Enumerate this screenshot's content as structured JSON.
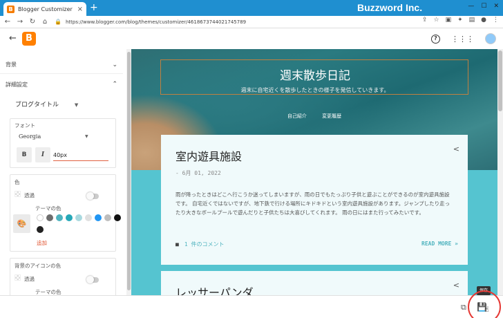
{
  "browser": {
    "tab_title": "Blogger Customizer",
    "tab_close": "×",
    "new_tab": "+",
    "brand": "Buzzword Inc.",
    "url": "https://www.blogger.com/blog/themes/customizer/4618673744021745789",
    "nav_back": "←",
    "nav_forward": "→",
    "nav_reload": "↻",
    "nav_home": "⌂",
    "lock": "🔒",
    "window_min": "—",
    "window_max": "☐",
    "window_close": "✕",
    "toolbar_icons": {
      "share": "⇪",
      "star": "☆",
      "ext": "▣",
      "puzzle": "✦",
      "sidebar": "▤",
      "profile": "●",
      "menu": "⋮"
    }
  },
  "header": {
    "back": "←",
    "logo_letter": "B",
    "help": "?",
    "apps": "⋮⋮⋮"
  },
  "sidebar": {
    "background_label": "背景",
    "advanced_label": "詳細設定",
    "chevron_down": "⌄",
    "chevron_up": "⌃",
    "selected_item": "ブログタイトル",
    "select_arrow": "▼",
    "font_card": {
      "label": "フォント",
      "font_name": "Georgia",
      "arrow": "▼",
      "bold": "B",
      "italic": "I",
      "size": "40px"
    },
    "color_card": {
      "label": "色",
      "transparent": "透過",
      "theme_colors": "テーマの色",
      "palette_icon": "🎨",
      "add": "追加",
      "colors": [
        "#ffffff",
        "#6d6d6d",
        "#4fb3bf",
        "#26a8b8",
        "#a9d9df",
        "#e0e0e0",
        "#2196f3",
        "#bdbdbd",
        "#111111",
        "#222222"
      ]
    },
    "icon_color_card": {
      "label": "背景のアイコンの色",
      "transparent": "透過",
      "theme_colors": "テーマの色"
    }
  },
  "preview": {
    "blog_title": "週末散歩日記",
    "blog_description": "週末に自宅近くを散歩したときの様子を発信していきます。",
    "nav": [
      "自己紹介",
      "変更履歴"
    ],
    "share_icon": "<",
    "post1": {
      "title": "室内遊具施設",
      "date": "- 6月 01, 2022",
      "body": "雨が降ったときはどこへ行こうか迷ってしまいますが、雨の日でもたっぷり子供と遊ぶことができるのが室内遊具施設です。 自宅近くではないですが、地下鉄で行ける場所にキドキドという室内遊具施設があります。ジャンプしたり走ったり大きなボールプールで遊んだりと子供たちは大喜びしてくれます。 雨の日にはまた行ってみたいです。",
      "comment_icon": "■",
      "comments": "1 件のコメント",
      "read_more": "READ MORE »"
    },
    "post2": {
      "title": "レッサーパンダ"
    }
  },
  "bottom": {
    "preview_icon": "⧉",
    "save_icon": "💾",
    "tooltip": "保存",
    "cursor": "☝"
  }
}
